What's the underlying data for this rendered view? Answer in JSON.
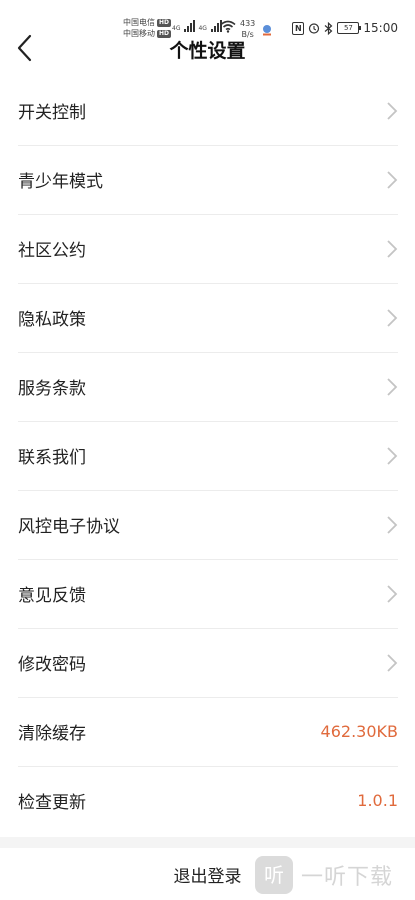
{
  "status_bar": {
    "carrier_1": "中国电信",
    "carrier_2": "中国移动",
    "hd_badge": "HD",
    "network_tag": "4G",
    "speed_value": "433",
    "speed_unit": "B/s",
    "nfc_label": "N",
    "battery_level": "57",
    "time": "15:00"
  },
  "header": {
    "title": "个性设置",
    "back_icon": "chevron-left-icon"
  },
  "menu": {
    "items": [
      {
        "label": "开关控制"
      },
      {
        "label": "青少年模式"
      },
      {
        "label": "社区公约"
      },
      {
        "label": "隐私政策"
      },
      {
        "label": "服务条款"
      },
      {
        "label": "联系我们"
      },
      {
        "label": "风控电子协议"
      },
      {
        "label": "意见反馈"
      },
      {
        "label": "修改密码"
      },
      {
        "label": "清除缓存",
        "value": "462.30KB"
      },
      {
        "label": "检查更新",
        "value": "1.0.1"
      }
    ]
  },
  "footer": {
    "logout_label": "退出登录"
  },
  "watermark": {
    "logo_glyph": "听",
    "text": "一听下载"
  },
  "colors": {
    "accent_value": "#e06a3c",
    "divider": "#ececec",
    "chevron": "#c4c4c4"
  }
}
